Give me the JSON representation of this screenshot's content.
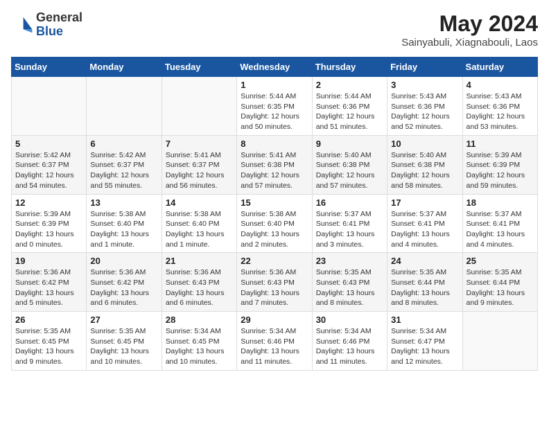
{
  "header": {
    "logo": {
      "general": "General",
      "blue": "Blue"
    },
    "month_year": "May 2024",
    "location": "Sainyabuli, Xiagnabouli, Laos"
  },
  "weekdays": [
    "Sunday",
    "Monday",
    "Tuesday",
    "Wednesday",
    "Thursday",
    "Friday",
    "Saturday"
  ],
  "weeks": [
    [
      {
        "day": "",
        "info": ""
      },
      {
        "day": "",
        "info": ""
      },
      {
        "day": "",
        "info": ""
      },
      {
        "day": "1",
        "info": "Sunrise: 5:44 AM\nSunset: 6:35 PM\nDaylight: 12 hours\nand 50 minutes."
      },
      {
        "day": "2",
        "info": "Sunrise: 5:44 AM\nSunset: 6:36 PM\nDaylight: 12 hours\nand 51 minutes."
      },
      {
        "day": "3",
        "info": "Sunrise: 5:43 AM\nSunset: 6:36 PM\nDaylight: 12 hours\nand 52 minutes."
      },
      {
        "day": "4",
        "info": "Sunrise: 5:43 AM\nSunset: 6:36 PM\nDaylight: 12 hours\nand 53 minutes."
      }
    ],
    [
      {
        "day": "5",
        "info": "Sunrise: 5:42 AM\nSunset: 6:37 PM\nDaylight: 12 hours\nand 54 minutes."
      },
      {
        "day": "6",
        "info": "Sunrise: 5:42 AM\nSunset: 6:37 PM\nDaylight: 12 hours\nand 55 minutes."
      },
      {
        "day": "7",
        "info": "Sunrise: 5:41 AM\nSunset: 6:37 PM\nDaylight: 12 hours\nand 56 minutes."
      },
      {
        "day": "8",
        "info": "Sunrise: 5:41 AM\nSunset: 6:38 PM\nDaylight: 12 hours\nand 57 minutes."
      },
      {
        "day": "9",
        "info": "Sunrise: 5:40 AM\nSunset: 6:38 PM\nDaylight: 12 hours\nand 57 minutes."
      },
      {
        "day": "10",
        "info": "Sunrise: 5:40 AM\nSunset: 6:38 PM\nDaylight: 12 hours\nand 58 minutes."
      },
      {
        "day": "11",
        "info": "Sunrise: 5:39 AM\nSunset: 6:39 PM\nDaylight: 12 hours\nand 59 minutes."
      }
    ],
    [
      {
        "day": "12",
        "info": "Sunrise: 5:39 AM\nSunset: 6:39 PM\nDaylight: 13 hours\nand 0 minutes."
      },
      {
        "day": "13",
        "info": "Sunrise: 5:38 AM\nSunset: 6:40 PM\nDaylight: 13 hours\nand 1 minute."
      },
      {
        "day": "14",
        "info": "Sunrise: 5:38 AM\nSunset: 6:40 PM\nDaylight: 13 hours\nand 1 minute."
      },
      {
        "day": "15",
        "info": "Sunrise: 5:38 AM\nSunset: 6:40 PM\nDaylight: 13 hours\nand 2 minutes."
      },
      {
        "day": "16",
        "info": "Sunrise: 5:37 AM\nSunset: 6:41 PM\nDaylight: 13 hours\nand 3 minutes."
      },
      {
        "day": "17",
        "info": "Sunrise: 5:37 AM\nSunset: 6:41 PM\nDaylight: 13 hours\nand 4 minutes."
      },
      {
        "day": "18",
        "info": "Sunrise: 5:37 AM\nSunset: 6:41 PM\nDaylight: 13 hours\nand 4 minutes."
      }
    ],
    [
      {
        "day": "19",
        "info": "Sunrise: 5:36 AM\nSunset: 6:42 PM\nDaylight: 13 hours\nand 5 minutes."
      },
      {
        "day": "20",
        "info": "Sunrise: 5:36 AM\nSunset: 6:42 PM\nDaylight: 13 hours\nand 6 minutes."
      },
      {
        "day": "21",
        "info": "Sunrise: 5:36 AM\nSunset: 6:43 PM\nDaylight: 13 hours\nand 6 minutes."
      },
      {
        "day": "22",
        "info": "Sunrise: 5:36 AM\nSunset: 6:43 PM\nDaylight: 13 hours\nand 7 minutes."
      },
      {
        "day": "23",
        "info": "Sunrise: 5:35 AM\nSunset: 6:43 PM\nDaylight: 13 hours\nand 8 minutes."
      },
      {
        "day": "24",
        "info": "Sunrise: 5:35 AM\nSunset: 6:44 PM\nDaylight: 13 hours\nand 8 minutes."
      },
      {
        "day": "25",
        "info": "Sunrise: 5:35 AM\nSunset: 6:44 PM\nDaylight: 13 hours\nand 9 minutes."
      }
    ],
    [
      {
        "day": "26",
        "info": "Sunrise: 5:35 AM\nSunset: 6:45 PM\nDaylight: 13 hours\nand 9 minutes."
      },
      {
        "day": "27",
        "info": "Sunrise: 5:35 AM\nSunset: 6:45 PM\nDaylight: 13 hours\nand 10 minutes."
      },
      {
        "day": "28",
        "info": "Sunrise: 5:34 AM\nSunset: 6:45 PM\nDaylight: 13 hours\nand 10 minutes."
      },
      {
        "day": "29",
        "info": "Sunrise: 5:34 AM\nSunset: 6:46 PM\nDaylight: 13 hours\nand 11 minutes."
      },
      {
        "day": "30",
        "info": "Sunrise: 5:34 AM\nSunset: 6:46 PM\nDaylight: 13 hours\nand 11 minutes."
      },
      {
        "day": "31",
        "info": "Sunrise: 5:34 AM\nSunset: 6:47 PM\nDaylight: 13 hours\nand 12 minutes."
      },
      {
        "day": "",
        "info": ""
      }
    ]
  ]
}
